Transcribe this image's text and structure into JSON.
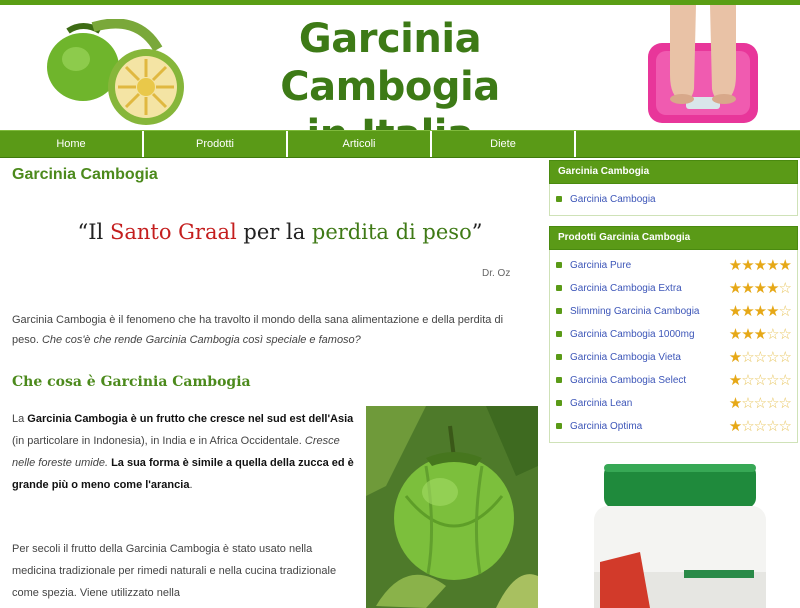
{
  "header": {
    "title_line1": "Garcinia Cambogia",
    "title_line2": "in Italia"
  },
  "nav": {
    "items": [
      "Home",
      "Prodotti",
      "Articoli",
      "Diete"
    ]
  },
  "main": {
    "title": "Garcinia Cambogia",
    "quote": {
      "open": "“Il ",
      "red": "Santo Graal",
      "mid": " per la ",
      "green": "perdita di peso",
      "close": "”",
      "author": "Dr. Oz"
    },
    "intro": {
      "text": "Garcinia Cambogia è il fenomeno che ha travolto il mondo della sana alimentazione e della perdita di peso. ",
      "italic": "Che cos'è che rende Garcinia Cambogia così speciale e famoso?"
    },
    "section_title": "Che cosa è Garcinia Cambogia",
    "p1": {
      "a": "La ",
      "b1": "Garcinia Cambogia è un frutto che cresce nel sud est dell'Asia",
      "c": " (in particolare in Indonesia), in India e in Africa Occidentale. ",
      "d": "Cresce nelle foreste umide.",
      "e": " ",
      "b2": "La sua forma è simile a quella della zucca ed è grande più o meno come l'arancia",
      "f": "."
    },
    "p2": "Per secoli il frutto della Garcinia Cambogia è stato usato nella medicina tradizionale per rimedi naturali e nella cucina tradizionale come spezia. Viene utilizzato nella"
  },
  "sidebar": {
    "box1_title": "Garcinia Cambogia",
    "box1_links": [
      "Garcinia Cambogia"
    ],
    "box2_title": "Prodotti Garcinia Cambogia",
    "products": [
      {
        "name": "Garcinia Pure",
        "rating": 5
      },
      {
        "name": "Garcinia Cambogia Extra",
        "rating": 4
      },
      {
        "name": "Slimming Garcinia Cambogia",
        "rating": 4
      },
      {
        "name": "Garcinia Cambogia 1000mg",
        "rating": 3
      },
      {
        "name": "Garcinia Cambogia Vieta",
        "rating": 1
      },
      {
        "name": "Garcinia Cambogia Select",
        "rating": 1
      },
      {
        "name": "Garcinia Lean",
        "rating": 1
      },
      {
        "name": "Garcinia Optima",
        "rating": 1
      }
    ]
  },
  "colors": {
    "brand_green": "#5a9a17",
    "title_green": "#3d7a16",
    "link_blue": "#3d56b8",
    "quote_red": "#c41e1e",
    "star_gold": "#e6a817"
  },
  "icons": [
    "fruit-image",
    "scale-image",
    "garcinia-photo",
    "supplement-jar-image",
    "star-icon",
    "bullet-icon"
  ]
}
